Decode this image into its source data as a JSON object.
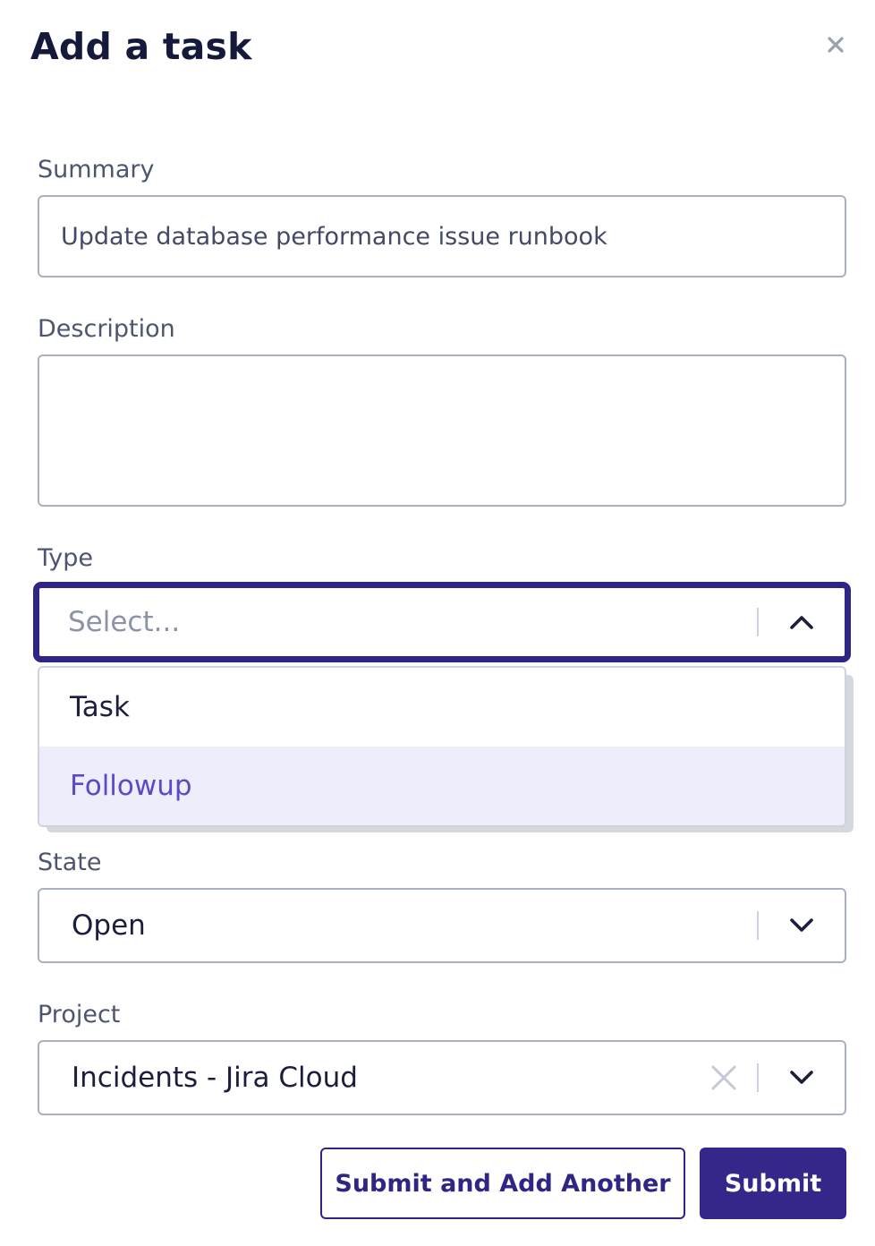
{
  "dialog": {
    "title": "Add a task",
    "close_icon": "close-icon"
  },
  "summary": {
    "label": "Summary",
    "value": "Update database performance issue runbook"
  },
  "description": {
    "label": "Description",
    "value": ""
  },
  "type": {
    "label": "Type",
    "placeholder": "Select...",
    "options": [
      "Task",
      "Followup"
    ],
    "highlighted_option": "Followup"
  },
  "state": {
    "label": "State",
    "value": "Open"
  },
  "project": {
    "label": "Project",
    "value": "Incidents - Jira Cloud"
  },
  "actions": {
    "submit_and_add_another": "Submit and Add Another",
    "submit": "Submit"
  },
  "colors": {
    "accent": "#2f2585",
    "highlight_bg": "#eeedfc",
    "highlight_text": "#5a49c8"
  }
}
